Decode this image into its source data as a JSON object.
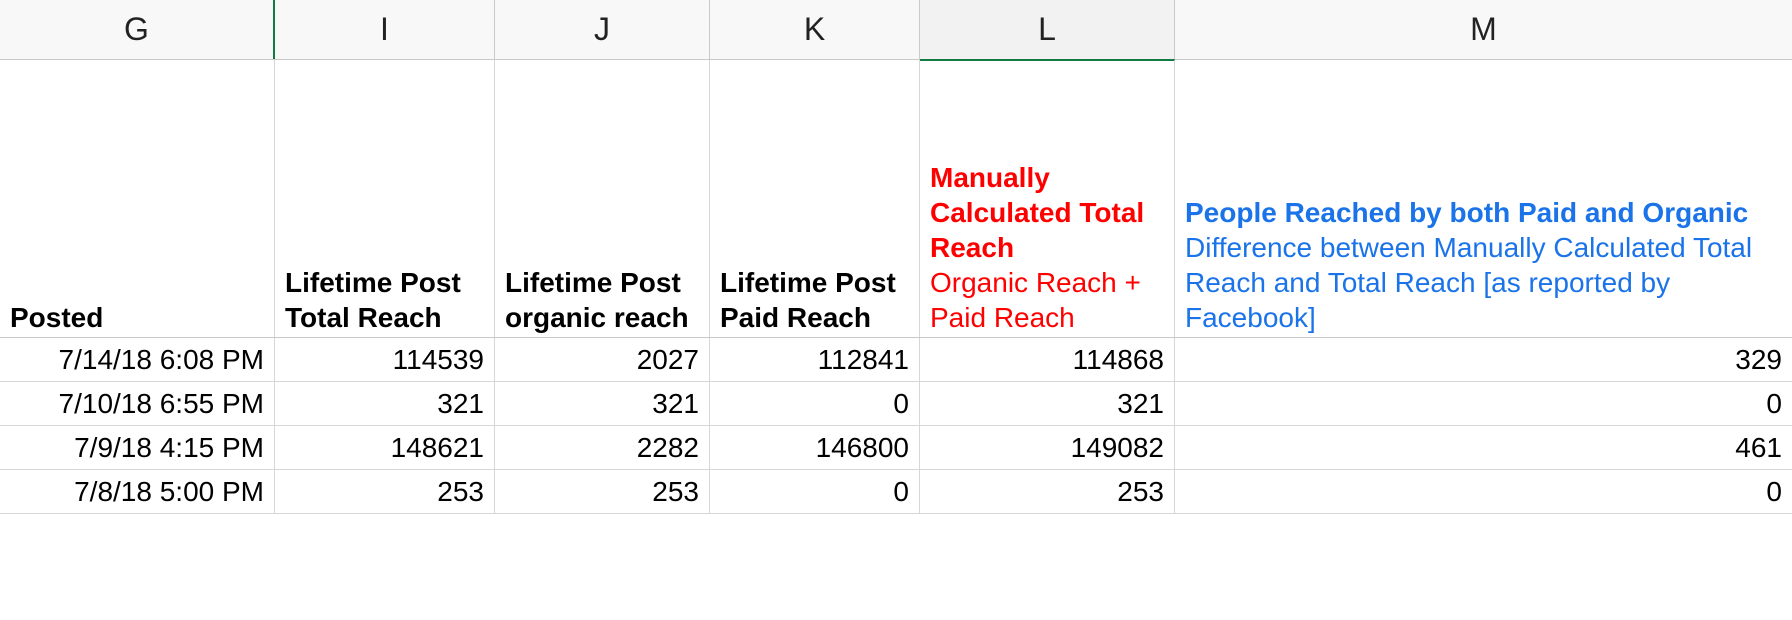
{
  "columns": [
    {
      "letter": "G",
      "field": {
        "title": "Posted"
      }
    },
    {
      "letter": "I",
      "field": {
        "title": "Lifetime Post Total Reach"
      }
    },
    {
      "letter": "J",
      "field": {
        "title": "Lifetime Post organic reach"
      }
    },
    {
      "letter": "K",
      "field": {
        "title": "Lifetime Post Paid Reach"
      }
    },
    {
      "letter": "L",
      "field": {
        "title": "Manually Calculated Total Reach",
        "sub": "Organic Reach + Paid Reach"
      }
    },
    {
      "letter": "M",
      "field": {
        "title": "People Reached by both Paid and Organic",
        "sub": "Difference between Manually Calculated Total Reach and Total Reach [as reported by Facebook]"
      }
    }
  ],
  "rows": [
    {
      "posted": "7/14/18 6:08 PM",
      "total_reach": "114539",
      "organic_reach": "2027",
      "paid_reach": "112841",
      "manual_total": "114868",
      "overlap": "329"
    },
    {
      "posted": "7/10/18 6:55 PM",
      "total_reach": "321",
      "organic_reach": "321",
      "paid_reach": "0",
      "manual_total": "321",
      "overlap": "0"
    },
    {
      "posted": "7/9/18 4:15 PM",
      "total_reach": "148621",
      "organic_reach": "2282",
      "paid_reach": "146800",
      "manual_total": "149082",
      "overlap": "461"
    },
    {
      "posted": "7/8/18 5:00 PM",
      "total_reach": "253",
      "organic_reach": "253",
      "paid_reach": "0",
      "manual_total": "253",
      "overlap": "0"
    }
  ],
  "selected_column": "L"
}
